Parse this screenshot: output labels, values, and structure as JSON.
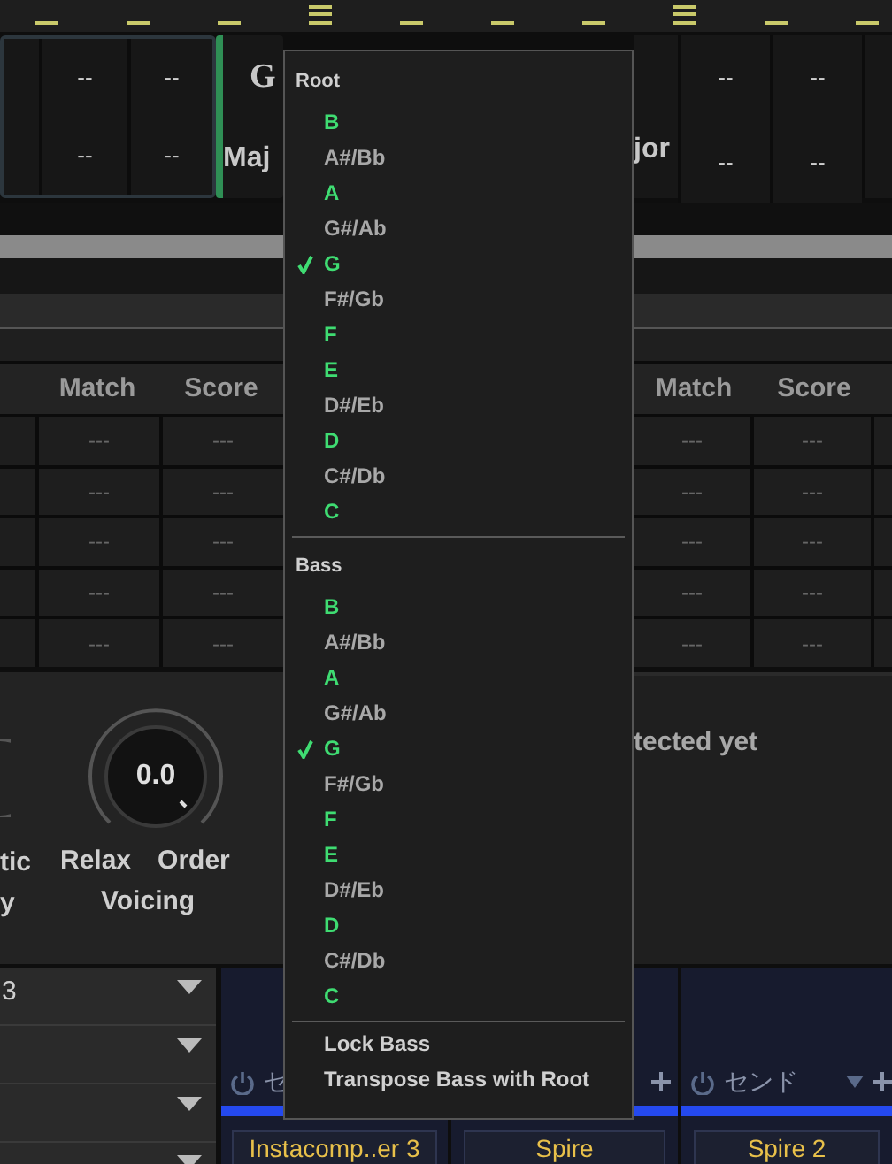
{
  "chord_track": {
    "left_cells": [
      {
        "top": "--",
        "bottom": "--"
      },
      {
        "top": "--",
        "bottom": "--"
      }
    ],
    "selected_chord": {
      "root": "G",
      "quality": "Maj",
      "selected": true
    },
    "right_chord": {
      "quality": "jor"
    },
    "right_cells": [
      {
        "top": "--",
        "bottom": "--"
      },
      {
        "top": "--",
        "bottom": "--"
      }
    ]
  },
  "table": {
    "left_columns": [
      "Match",
      "Score"
    ],
    "right_columns": [
      "Match",
      "Score"
    ],
    "rows": [
      {
        "left": [
          "---",
          "---"
        ],
        "right": [
          "---",
          "---"
        ]
      },
      {
        "left": [
          "---",
          "---"
        ],
        "right": [
          "---",
          "---"
        ]
      },
      {
        "left": [
          "---",
          "---"
        ],
        "right": [
          "---",
          "---"
        ]
      },
      {
        "left": [
          "---",
          "---"
        ],
        "right": [
          "---",
          "---"
        ]
      },
      {
        "left": [
          "---",
          "---"
        ],
        "right": [
          "---",
          "---"
        ]
      }
    ]
  },
  "voicing": {
    "cut_label_lines": [
      "tic",
      "y"
    ],
    "knob_value": "0.0",
    "knob_ends": [
      "Relax",
      "Order"
    ],
    "title": "Voicing"
  },
  "status": "tected yet",
  "track_rows": [
    {
      "kind": "named",
      "name": "3"
    },
    {
      "kind": "blank"
    },
    {
      "kind": "blank"
    },
    {
      "kind": "blank"
    }
  ],
  "mixer": {
    "channels": [
      {
        "send": "セ",
        "plugin": "Instacomp..er 3"
      },
      {
        "plugin": "Spire"
      },
      {
        "send": "センド",
        "plugin": "Spire 2"
      }
    ]
  },
  "menu": {
    "sections": [
      {
        "title": "Root",
        "items": [
          {
            "label": "B",
            "in_key": true,
            "checked": false
          },
          {
            "label": "A#/Bb",
            "in_key": false,
            "checked": false
          },
          {
            "label": "A",
            "in_key": true,
            "checked": false
          },
          {
            "label": "G#/Ab",
            "in_key": false,
            "checked": false
          },
          {
            "label": "G",
            "in_key": true,
            "checked": true
          },
          {
            "label": "F#/Gb",
            "in_key": false,
            "checked": false
          },
          {
            "label": "F",
            "in_key": true,
            "checked": false
          },
          {
            "label": "E",
            "in_key": true,
            "checked": false
          },
          {
            "label": "D#/Eb",
            "in_key": false,
            "checked": false
          },
          {
            "label": "D",
            "in_key": true,
            "checked": false
          },
          {
            "label": "C#/Db",
            "in_key": false,
            "checked": false
          },
          {
            "label": "C",
            "in_key": true,
            "checked": false
          }
        ]
      },
      {
        "title": "Bass",
        "items": [
          {
            "label": "B",
            "in_key": true,
            "checked": false
          },
          {
            "label": "A#/Bb",
            "in_key": false,
            "checked": false
          },
          {
            "label": "A",
            "in_key": true,
            "checked": false
          },
          {
            "label": "G#/Ab",
            "in_key": false,
            "checked": false
          },
          {
            "label": "G",
            "in_key": true,
            "checked": true
          },
          {
            "label": "F#/Gb",
            "in_key": false,
            "checked": false
          },
          {
            "label": "F",
            "in_key": true,
            "checked": false
          },
          {
            "label": "E",
            "in_key": true,
            "checked": false
          },
          {
            "label": "D#/Eb",
            "in_key": false,
            "checked": false
          },
          {
            "label": "D",
            "in_key": true,
            "checked": false
          },
          {
            "label": "C#/Db",
            "in_key": false,
            "checked": false
          },
          {
            "label": "C",
            "in_key": true,
            "checked": false
          }
        ]
      }
    ],
    "actions": [
      "Lock Bass",
      "Transpose Bass with Root"
    ]
  }
}
